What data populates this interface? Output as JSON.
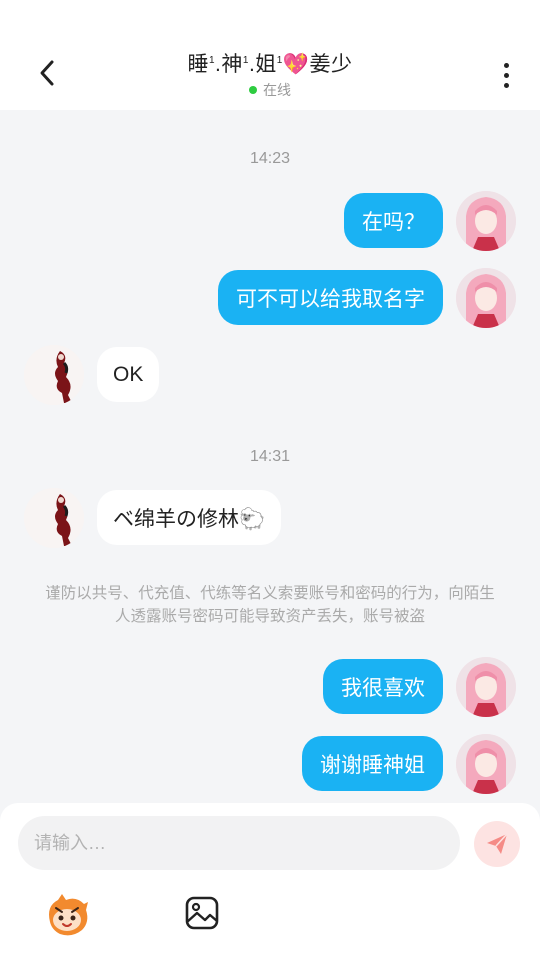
{
  "header": {
    "title_parts": [
      "睡",
      "1",
      ".神",
      "1",
      ".姐",
      "1",
      "💖",
      "姜少"
    ],
    "status": "在线",
    "status_color": "#2ecc40"
  },
  "messages": {
    "t1": "14:23",
    "m1": "在吗？",
    "m2": "可不可以给我取名字",
    "m3": "OK",
    "t2": "14:31",
    "m4": "ベ绵羊の修林🐑",
    "warning": "谨防以共号、代充值、代练等名义索要账号和密码的行为，向陌生人透露账号密码可能导致资产丢失，账号被盗",
    "m5": "我很喜欢",
    "m6": "谢谢睡神姐"
  },
  "composer": {
    "placeholder": "请输入…"
  },
  "colors": {
    "accent": "#1ab2f3",
    "send_bg": "#fde3e2",
    "send_icon": "#f58b86"
  },
  "icons": [
    "back-arrow-icon",
    "more-dots-icon",
    "send-icon",
    "emoji-mascot-icon",
    "image-icon"
  ]
}
